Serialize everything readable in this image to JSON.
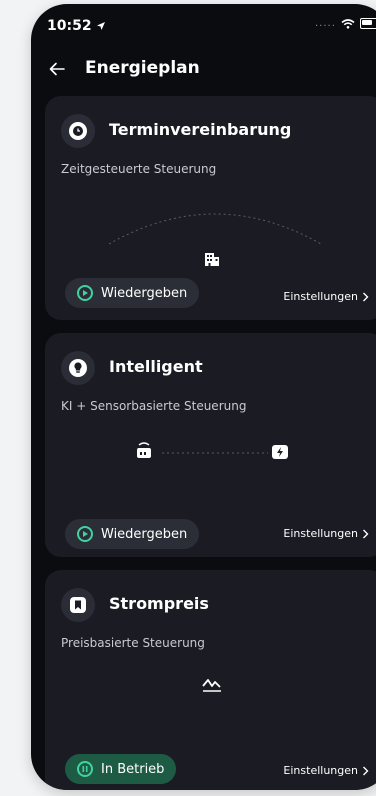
{
  "status_bar": {
    "time": "10:52"
  },
  "header": {
    "title": "Energieplan"
  },
  "cards": [
    {
      "title": "Terminvereinbarung",
      "subtitle": "Zeitgesteuerte Steuerung",
      "action_label": "Wiedergeben",
      "settings_label": "Einstellungen"
    },
    {
      "title": "Intelligent",
      "subtitle": "KI + Sensorbasierte Steuerung",
      "action_label": "Wiedergeben",
      "settings_label": "Einstellungen"
    },
    {
      "title": "Strompreis",
      "subtitle": "Preisbasierte Steuerung",
      "action_label": "In Betrieb",
      "settings_label": "Einstellungen"
    }
  ],
  "colors": {
    "accent": "#3fd3a0",
    "active_pill": "#1e5b45",
    "card": "#1a1b23",
    "background": "#0b0c10"
  }
}
